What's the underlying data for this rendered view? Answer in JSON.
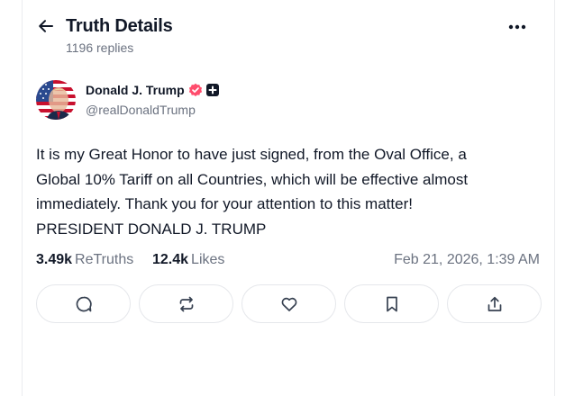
{
  "header": {
    "title": "Truth Details",
    "replies": "1196 replies",
    "icons": {
      "back": "arrow-left-icon",
      "more": "more-horizontal-icon"
    }
  },
  "post": {
    "author": {
      "name": "Donald J. Trump",
      "handle": "@realDonaldTrump",
      "verified_color": "#ff4d6d"
    },
    "text_lines": [
      "It is my Great Honor to have just signed, from the Oval Office, a",
      "Global 10% Tariff on all Countries, which will be effective almost",
      "immediately. Thank you for your attention to this matter!",
      "PRESIDENT DONALD J. TRUMP"
    ],
    "stats": {
      "retruths_count": "3.49k",
      "retruths_label": "ReTruths",
      "likes_count": "12.4k",
      "likes_label": "Likes"
    },
    "timestamp": "Feb 21, 2026, 1:39 AM"
  },
  "actions": [
    {
      "name": "reply",
      "icon": "comment-icon"
    },
    {
      "name": "retruth",
      "icon": "repost-icon"
    },
    {
      "name": "like",
      "icon": "heart-icon"
    },
    {
      "name": "bookmark",
      "icon": "bookmark-icon"
    },
    {
      "name": "share",
      "icon": "share-icon"
    }
  ],
  "colors": {
    "text": "#111827",
    "muted": "#6b7280",
    "border": "#e5e7eb",
    "verified": "#ff4d6d"
  }
}
